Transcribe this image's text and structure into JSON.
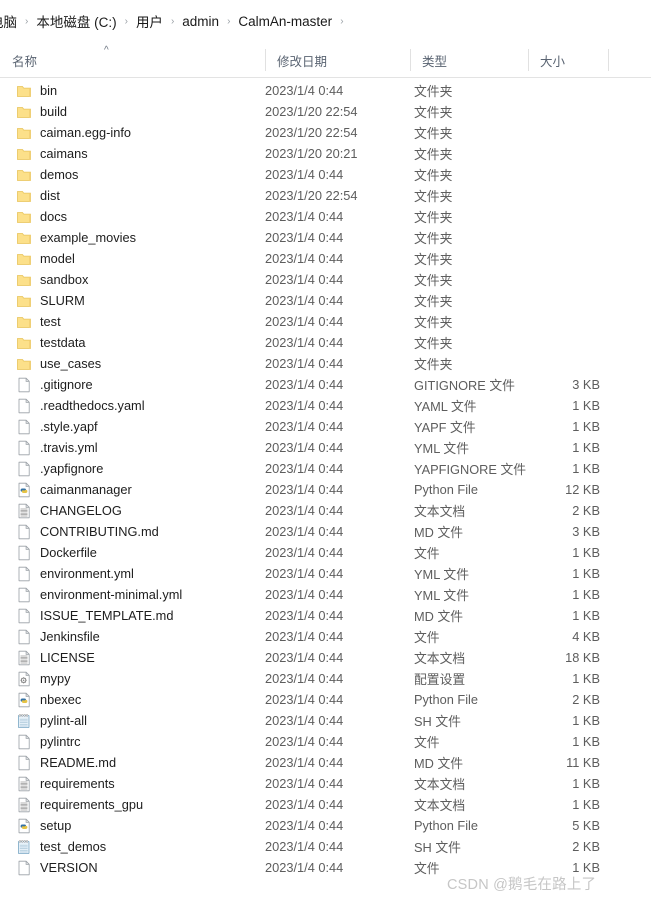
{
  "window": {
    "title": "CalmAn-master"
  },
  "breadcrumb": {
    "separator": "›",
    "items": [
      {
        "label": "电脑"
      },
      {
        "label": "本地磁盘 (C:)"
      },
      {
        "label": "用户"
      },
      {
        "label": "admin"
      },
      {
        "label": "CalmAn-master"
      }
    ]
  },
  "columns": {
    "name": "名称",
    "date_modified": "修改日期",
    "type": "类型",
    "size": "大小",
    "sort_indicator": "^",
    "sort_column": "名称",
    "sort_direction": "ascending"
  },
  "colors": {
    "folder_fill": "#FCE08A",
    "folder_edge": "#E8C35A",
    "text_primary": "#1d1d1d",
    "text_secondary": "#5d5d5d",
    "header_text": "#5a6472",
    "watermark": "#c6c6c6"
  },
  "watermark": "CSDN @鹅毛在路上了",
  "files": [
    {
      "name": "bin",
      "icon": "folder-icon",
      "date": "2023/1/4 0:44",
      "type": "文件夹",
      "size": ""
    },
    {
      "name": "build",
      "icon": "folder-icon",
      "date": "2023/1/20 22:54",
      "type": "文件夹",
      "size": ""
    },
    {
      "name": "caiman.egg-info",
      "icon": "folder-icon",
      "date": "2023/1/20 22:54",
      "type": "文件夹",
      "size": ""
    },
    {
      "name": "caimans",
      "icon": "folder-icon",
      "date": "2023/1/20 20:21",
      "type": "文件夹",
      "size": ""
    },
    {
      "name": "demos",
      "icon": "folder-icon",
      "date": "2023/1/4 0:44",
      "type": "文件夹",
      "size": ""
    },
    {
      "name": "dist",
      "icon": "folder-icon",
      "date": "2023/1/20 22:54",
      "type": "文件夹",
      "size": ""
    },
    {
      "name": "docs",
      "icon": "folder-icon",
      "date": "2023/1/4 0:44",
      "type": "文件夹",
      "size": ""
    },
    {
      "name": "example_movies",
      "icon": "folder-icon",
      "date": "2023/1/4 0:44",
      "type": "文件夹",
      "size": ""
    },
    {
      "name": "model",
      "icon": "folder-icon",
      "date": "2023/1/4 0:44",
      "type": "文件夹",
      "size": ""
    },
    {
      "name": "sandbox",
      "icon": "folder-icon",
      "date": "2023/1/4 0:44",
      "type": "文件夹",
      "size": ""
    },
    {
      "name": "SLURM",
      "icon": "folder-icon",
      "date": "2023/1/4 0:44",
      "type": "文件夹",
      "size": ""
    },
    {
      "name": "test",
      "icon": "folder-icon",
      "date": "2023/1/4 0:44",
      "type": "文件夹",
      "size": ""
    },
    {
      "name": "testdata",
      "icon": "folder-icon",
      "date": "2023/1/4 0:44",
      "type": "文件夹",
      "size": ""
    },
    {
      "name": "use_cases",
      "icon": "folder-icon",
      "date": "2023/1/4 0:44",
      "type": "文件夹",
      "size": ""
    },
    {
      "name": ".gitignore",
      "icon": "blank-file-icon",
      "date": "2023/1/4 0:44",
      "type": "GITIGNORE 文件",
      "size": "3 KB"
    },
    {
      "name": ".readthedocs.yaml",
      "icon": "blank-file-icon",
      "date": "2023/1/4 0:44",
      "type": "YAML 文件",
      "size": "1 KB"
    },
    {
      "name": ".style.yapf",
      "icon": "blank-file-icon",
      "date": "2023/1/4 0:44",
      "type": "YAPF 文件",
      "size": "1 KB"
    },
    {
      "name": ".travis.yml",
      "icon": "blank-file-icon",
      "date": "2023/1/4 0:44",
      "type": "YML 文件",
      "size": "1 KB"
    },
    {
      "name": ".yapfignore",
      "icon": "blank-file-icon",
      "date": "2023/1/4 0:44",
      "type": "YAPFIGNORE 文件",
      "size": "1 KB"
    },
    {
      "name": "caimanmanager",
      "icon": "python-file-icon",
      "date": "2023/1/4 0:44",
      "type": "Python File",
      "size": "12 KB"
    },
    {
      "name": "CHANGELOG",
      "icon": "text-document-icon",
      "date": "2023/1/4 0:44",
      "type": "文本文档",
      "size": "2 KB"
    },
    {
      "name": "CONTRIBUTING.md",
      "icon": "blank-file-icon",
      "date": "2023/1/4 0:44",
      "type": "MD 文件",
      "size": "3 KB"
    },
    {
      "name": "Dockerfile",
      "icon": "blank-file-icon",
      "date": "2023/1/4 0:44",
      "type": "文件",
      "size": "1 KB"
    },
    {
      "name": "environment.yml",
      "icon": "blank-file-icon",
      "date": "2023/1/4 0:44",
      "type": "YML 文件",
      "size": "1 KB"
    },
    {
      "name": "environment-minimal.yml",
      "icon": "blank-file-icon",
      "date": "2023/1/4 0:44",
      "type": "YML 文件",
      "size": "1 KB"
    },
    {
      "name": "ISSUE_TEMPLATE.md",
      "icon": "blank-file-icon",
      "date": "2023/1/4 0:44",
      "type": "MD 文件",
      "size": "1 KB"
    },
    {
      "name": "Jenkinsfile",
      "icon": "blank-file-icon",
      "date": "2023/1/4 0:44",
      "type": "文件",
      "size": "4 KB"
    },
    {
      "name": "LICENSE",
      "icon": "text-document-icon",
      "date": "2023/1/4 0:44",
      "type": "文本文档",
      "size": "18 KB"
    },
    {
      "name": "mypy",
      "icon": "config-file-icon",
      "date": "2023/1/4 0:44",
      "type": "配置设置",
      "size": "1 KB"
    },
    {
      "name": "nbexec",
      "icon": "python-file-icon",
      "date": "2023/1/4 0:44",
      "type": "Python File",
      "size": "2 KB"
    },
    {
      "name": "pylint-all",
      "icon": "notepad-file-icon",
      "date": "2023/1/4 0:44",
      "type": "SH 文件",
      "size": "1 KB"
    },
    {
      "name": "pylintrc",
      "icon": "blank-file-icon",
      "date": "2023/1/4 0:44",
      "type": "文件",
      "size": "1 KB"
    },
    {
      "name": "README.md",
      "icon": "blank-file-icon",
      "date": "2023/1/4 0:44",
      "type": "MD 文件",
      "size": "11 KB"
    },
    {
      "name": "requirements",
      "icon": "text-document-icon",
      "date": "2023/1/4 0:44",
      "type": "文本文档",
      "size": "1 KB"
    },
    {
      "name": "requirements_gpu",
      "icon": "text-document-icon",
      "date": "2023/1/4 0:44",
      "type": "文本文档",
      "size": "1 KB"
    },
    {
      "name": "setup",
      "icon": "python-file-icon",
      "date": "2023/1/4 0:44",
      "type": "Python File",
      "size": "5 KB"
    },
    {
      "name": "test_demos",
      "icon": "notepad-file-icon",
      "date": "2023/1/4 0:44",
      "type": "SH 文件",
      "size": "2 KB"
    },
    {
      "name": "VERSION",
      "icon": "blank-file-icon",
      "date": "2023/1/4 0:44",
      "type": "文件",
      "size": "1 KB"
    }
  ]
}
